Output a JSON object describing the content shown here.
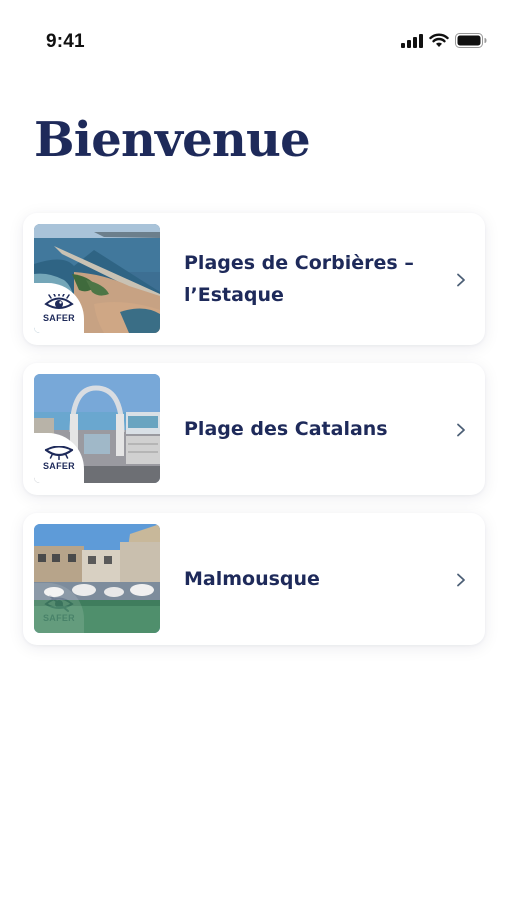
{
  "status_bar": {
    "time": "9:41",
    "icons": [
      "signal-icon",
      "wifi-icon",
      "battery-icon"
    ]
  },
  "page": {
    "title": "Bienvenue"
  },
  "beaches": [
    {
      "name": "Plages de Corbières – l’Estaque",
      "badge": "SAFER",
      "badge_state": "active",
      "image": "aerial-beach-photo"
    },
    {
      "name": "Plage des Catalans",
      "badge": "SAFER",
      "badge_state": "closed-eye",
      "image": "catalans-entrance-photo"
    },
    {
      "name": "Malmousque",
      "badge": "SAFER",
      "badge_state": "inactive",
      "image": "harbor-photo"
    }
  ],
  "colors": {
    "primary": "#1e2a5a",
    "background": "#ffffff",
    "card_shadow": "#e6e8ef"
  }
}
